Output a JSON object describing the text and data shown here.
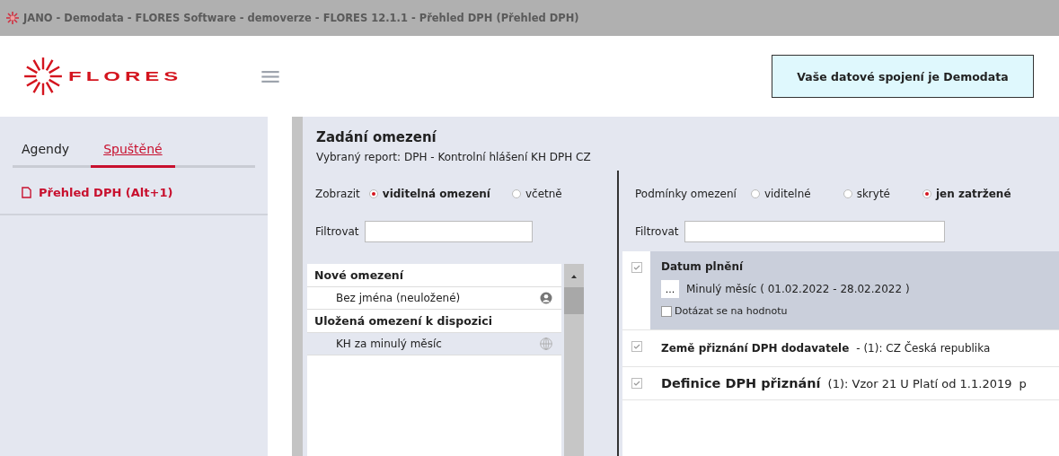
{
  "window": {
    "title": "JANO - Demodata - FLORES Software - demoverze - FLORES 12.1.1 - Přehled DPH  (Přehled DPH)"
  },
  "header": {
    "logo_text": "FLORES",
    "connection_button": "Vaše datové spojení je Demodata"
  },
  "sidebar": {
    "tabs": [
      {
        "label": "Agendy",
        "selected": false
      },
      {
        "label": "Spuštěné",
        "selected": true
      }
    ],
    "items": [
      {
        "label": "Přehled DPH (Alt+1)"
      }
    ]
  },
  "main": {
    "title": "Zadání omezení",
    "subtitle": "Vybraný report: DPH - Kontrolní hlášení KH DPH CZ",
    "left": {
      "show_label": "Zobrazit",
      "show_options": [
        {
          "label": "viditelná omezení",
          "selected": true
        },
        {
          "label": "včetně",
          "selected": false
        }
      ],
      "filter_label": "Filtrovat",
      "groups": [
        {
          "title": "Nové omezení",
          "items": [
            {
              "label": "Bez jména (neuložené)",
              "kind": "user",
              "selected": false
            }
          ]
        },
        {
          "title": "Uložená omezení k dispozici",
          "items": [
            {
              "label": "KH za minulý měsíc",
              "kind": "globe",
              "selected": true
            }
          ]
        }
      ]
    },
    "right": {
      "conditions_label": "Podmínky omezení",
      "condition_options": [
        {
          "label": "viditelné",
          "selected": false
        },
        {
          "label": "skryté",
          "selected": false
        },
        {
          "label": "jen zatržené",
          "selected": true
        }
      ],
      "filter_label": "Filtrovat",
      "conditions": [
        {
          "kind": "expanded",
          "name": "Datum plnění",
          "checked": true,
          "value_button": "...",
          "value": "Minulý měsíc ( 01.02.2022 - 28.02.2022 )",
          "ask_label": "Dotázat se na hodnotu",
          "ask_checked": false
        },
        {
          "kind": "row",
          "name": "Země přiznání DPH dodavatele",
          "checked": true,
          "detail": "- (1): CZ Česká republika"
        },
        {
          "kind": "large",
          "name": "Definice DPH přiznání",
          "checked": true,
          "detail": "(1): Vzor 21 U Platí od 1.1.2019",
          "cut_text": "p"
        }
      ]
    }
  }
}
